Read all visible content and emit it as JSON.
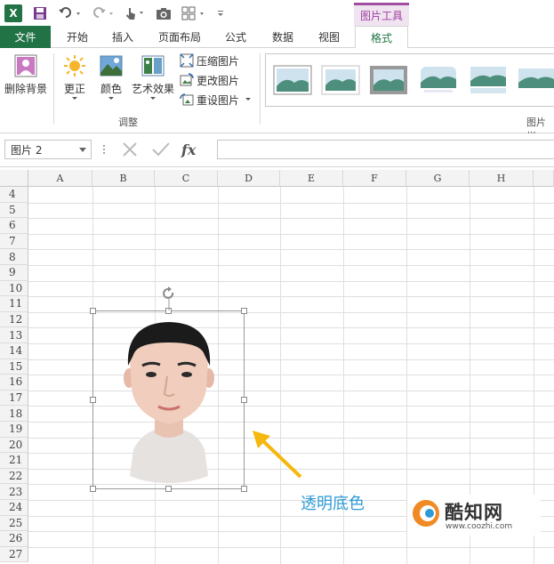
{
  "qat": {
    "logo": "X",
    "context_tab_header": "图片工具"
  },
  "tabs": [
    {
      "label": "文件"
    },
    {
      "label": "开始"
    },
    {
      "label": "插入"
    },
    {
      "label": "页面布局"
    },
    {
      "label": "公式"
    },
    {
      "label": "数据"
    },
    {
      "label": "视图"
    },
    {
      "label": "格式"
    }
  ],
  "ribbon": {
    "remove_bg": "删除背景",
    "corrections": "更正",
    "color": "颜色",
    "artistic": "艺术效果",
    "compress": "压缩图片",
    "change": "更改图片",
    "reset": "重设图片",
    "adjust_group": "调整",
    "styles_group": "图片样"
  },
  "formula_bar": {
    "name_box": "图片 2",
    "fx": "fx",
    "formula": ""
  },
  "grid": {
    "columns": [
      "A",
      "B",
      "C",
      "D",
      "E",
      "F",
      "G",
      "H"
    ],
    "rows": [
      "4",
      "5",
      "6",
      "7",
      "8",
      "9",
      "10",
      "11",
      "12",
      "13",
      "14",
      "15",
      "16",
      "17",
      "18",
      "19",
      "20",
      "21",
      "22",
      "23",
      "24",
      "25",
      "26",
      "27"
    ]
  },
  "annotation": {
    "text": "透明底色"
  },
  "watermark": {
    "brand": "酷知网",
    "url": "www.coozhi.com"
  },
  "colors": {
    "excel_green": "#217346",
    "context_purple": "#a03fa3",
    "annotation_blue": "#2e9bd6",
    "arrow_yellow": "#f5b80f"
  }
}
